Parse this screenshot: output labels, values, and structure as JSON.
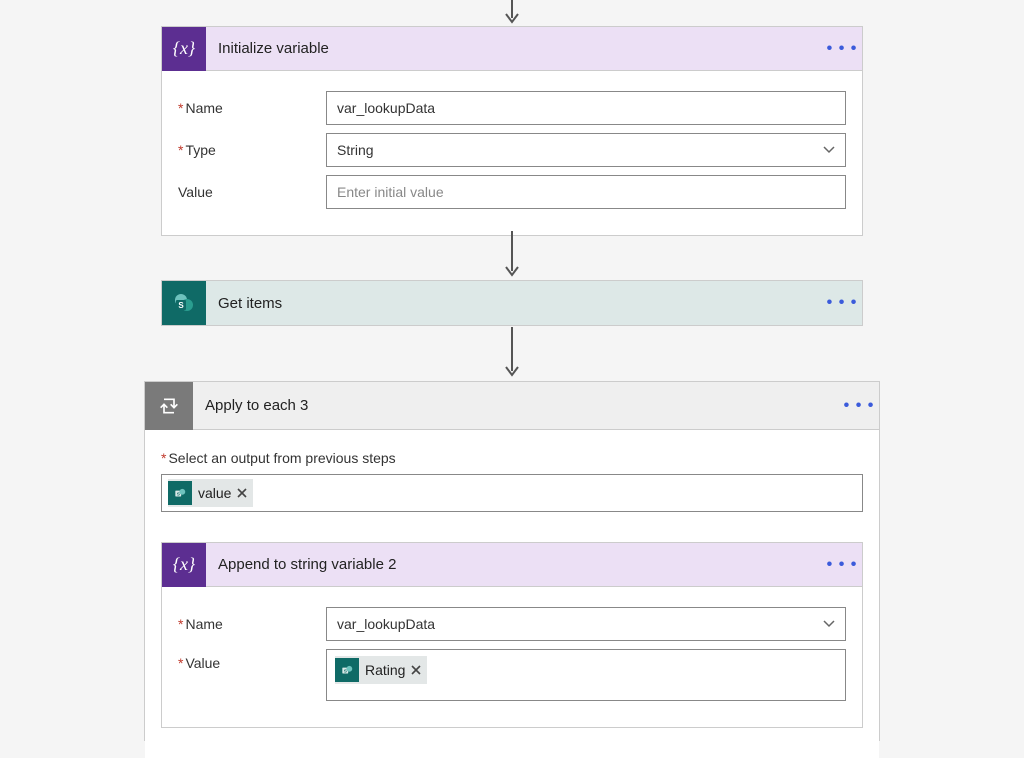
{
  "initVar": {
    "title": "Initialize variable",
    "icon_glyph": "{x}",
    "fields": {
      "name_label": "Name",
      "name_value": "var_lookupData",
      "type_label": "Type",
      "type_value": "String",
      "value_label": "Value",
      "value_placeholder": "Enter initial value"
    }
  },
  "getItems": {
    "title": "Get items"
  },
  "applyEach": {
    "title": "Apply to each 3",
    "output_label": "Select an output from previous steps",
    "output_token": "value"
  },
  "appendVar": {
    "title": "Append to string variable 2",
    "icon_glyph": "{x}",
    "fields": {
      "name_label": "Name",
      "name_value": "var_lookupData",
      "value_label": "Value",
      "value_token": "Rating"
    }
  },
  "moreDots": "• • •"
}
